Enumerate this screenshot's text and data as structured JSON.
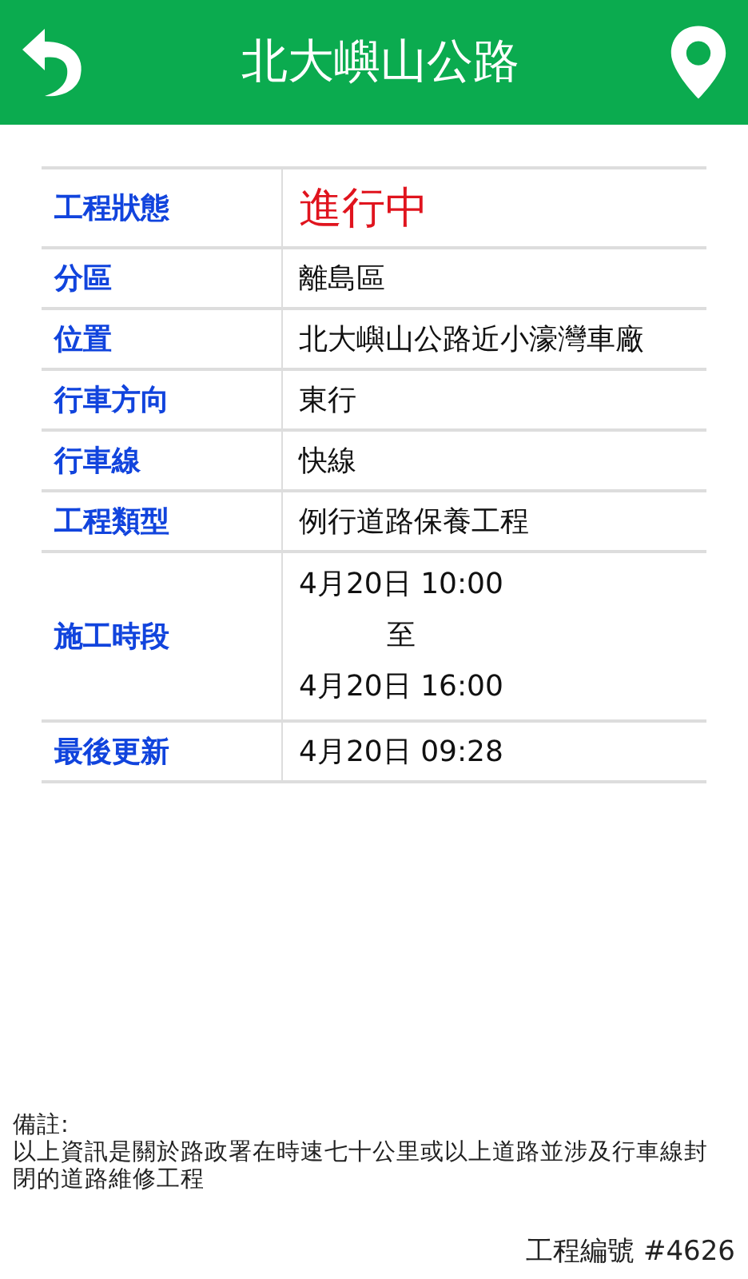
{
  "header": {
    "title": "北大嶼山公路"
  },
  "rows": [
    {
      "label": "工程狀態",
      "kind": "status",
      "value": "進行中"
    },
    {
      "label": "分區",
      "kind": "text",
      "value": "離島區"
    },
    {
      "label": "位置",
      "kind": "text",
      "value": "北大嶼山公路近小濠灣車廠"
    },
    {
      "label": "行車方向",
      "kind": "text",
      "value": "東行"
    },
    {
      "label": "行車線",
      "kind": "text",
      "value": "快線"
    },
    {
      "label": "工程類型",
      "kind": "text",
      "value": "例行道路保養工程"
    },
    {
      "label": "施工時段",
      "kind": "period",
      "from": "4月20日 10:00",
      "separator": "至",
      "to": "4月20日 16:00"
    },
    {
      "label": "最後更新",
      "kind": "text",
      "value": "4月20日 09:28"
    }
  ],
  "note": {
    "heading": "備註:",
    "text": "以上資訊是關於路政署在時速七十公里或以上道路並涉及行車線封閉的道路維修工程"
  },
  "project_number": "工程編號 #4626"
}
